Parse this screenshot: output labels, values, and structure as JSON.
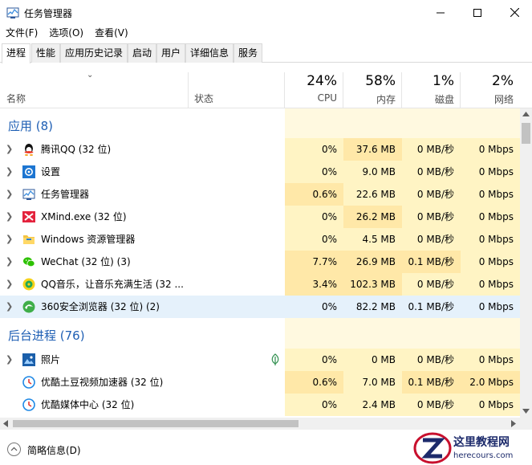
{
  "window": {
    "title": "任务管理器",
    "icon": "task-manager-icon"
  },
  "menu": [
    "文件(F)",
    "选项(O)",
    "查看(V)"
  ],
  "tabs": [
    "进程",
    "性能",
    "应用历史记录",
    "启动",
    "用户",
    "详细信息",
    "服务"
  ],
  "active_tab": "进程",
  "header": {
    "name": "名称",
    "status": "状态",
    "cpu": {
      "pct": "24%",
      "label": "CPU"
    },
    "memory": {
      "pct": "58%",
      "label": "内存"
    },
    "disk": {
      "pct": "1%",
      "label": "磁盘"
    },
    "network": {
      "pct": "2%",
      "label": "网络"
    }
  },
  "groups": {
    "apps": "应用 (8)",
    "background": "后台进程 (76)"
  },
  "apps": [
    {
      "name": "腾讯QQ (32 位)",
      "icon": "qq-penguin-icon",
      "cpu": "0%",
      "mem": "37.6 MB",
      "disk": "0 MB/秒",
      "net": "0 Mbps"
    },
    {
      "name": "设置",
      "icon": "gear-icon",
      "cpu": "0%",
      "mem": "9.0 MB",
      "disk": "0 MB/秒",
      "net": "0 Mbps"
    },
    {
      "name": "任务管理器",
      "icon": "task-manager-icon",
      "cpu": "0.6%",
      "mem": "22.6 MB",
      "disk": "0 MB/秒",
      "net": "0 Mbps"
    },
    {
      "name": "XMind.exe (32 位)",
      "icon": "xmind-icon",
      "cpu": "0%",
      "mem": "26.2 MB",
      "disk": "0 MB/秒",
      "net": "0 Mbps"
    },
    {
      "name": "Windows 资源管理器",
      "icon": "folder-icon",
      "cpu": "0%",
      "mem": "4.5 MB",
      "disk": "0 MB/秒",
      "net": "0 Mbps"
    },
    {
      "name": "WeChat (32 位) (3)",
      "icon": "wechat-icon",
      "cpu": "7.7%",
      "mem": "26.9 MB",
      "disk": "0.1 MB/秒",
      "net": "0 Mbps"
    },
    {
      "name": "QQ音乐，让音乐充满生活 (32 ...",
      "icon": "qq-music-icon",
      "cpu": "3.4%",
      "mem": "102.3 MB",
      "disk": "0 MB/秒",
      "net": "0 Mbps"
    },
    {
      "name": "360安全浏览器 (32 位) (2)",
      "icon": "browser-360-icon",
      "cpu": "0%",
      "mem": "82.2 MB",
      "disk": "0.1 MB/秒",
      "net": "0 Mbps"
    }
  ],
  "background": [
    {
      "name": "照片",
      "icon": "photos-icon",
      "cpu": "0%",
      "mem": "0 MB",
      "disk": "0 MB/秒",
      "net": "0 Mbps",
      "status_icon": "leaf-icon"
    },
    {
      "name": "优酷土豆视频加速器 (32 位)",
      "icon": "youku-icon",
      "cpu": "0.6%",
      "mem": "7.0 MB",
      "disk": "0.1 MB/秒",
      "net": "2.0 Mbps"
    },
    {
      "name": "优酷媒体中心 (32 位)",
      "icon": "youku-icon",
      "cpu": "0%",
      "mem": "2.4 MB",
      "disk": "0 MB/秒",
      "net": "0 Mbps"
    }
  ],
  "footer": {
    "label": "简略信息(D)"
  },
  "watermark": {
    "title": "这里教程网",
    "url": "herecours.com"
  }
}
